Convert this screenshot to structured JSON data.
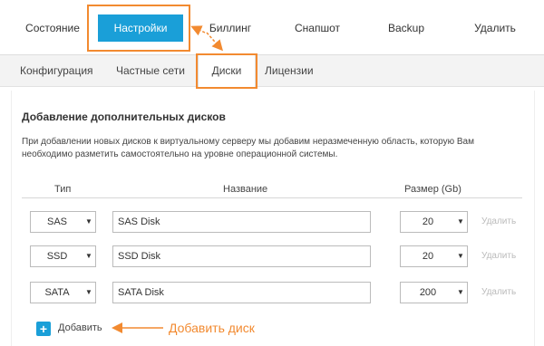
{
  "top_tabs": [
    {
      "label": "Состояние"
    },
    {
      "label": "Настройки"
    },
    {
      "label": "Биллинг"
    },
    {
      "label": "Снапшот"
    },
    {
      "label": "Backup"
    },
    {
      "label": "Удалить"
    }
  ],
  "sub_tabs": [
    {
      "label": "Конфигурация"
    },
    {
      "label": "Частные сети"
    },
    {
      "label": "Диски"
    },
    {
      "label": "Лицензии"
    }
  ],
  "section": {
    "title": "Добавление дополнительных дисков",
    "description": "При добавлении новых дисков к виртуальному серверу мы добавим неразмеченную область, которую Вам необходимо разметить самостоятельно на уровне операционной системы."
  },
  "columns": {
    "type": "Тип",
    "name": "Название",
    "size": "Размер (Gb)"
  },
  "disks": [
    {
      "type": "SAS",
      "name": "SAS Disk",
      "size": "20",
      "delete": "Удалить"
    },
    {
      "type": "SSD",
      "name": "SSD Disk",
      "size": "20",
      "delete": "Удалить"
    },
    {
      "type": "SATA",
      "name": "SATA Disk",
      "size": "200",
      "delete": "Удалить"
    }
  ],
  "add_button": {
    "icon": "+",
    "label": "Добавить"
  },
  "annotation": "Добавить диск",
  "colors": {
    "accent": "#1a9fd8",
    "highlight": "#f28a30"
  }
}
